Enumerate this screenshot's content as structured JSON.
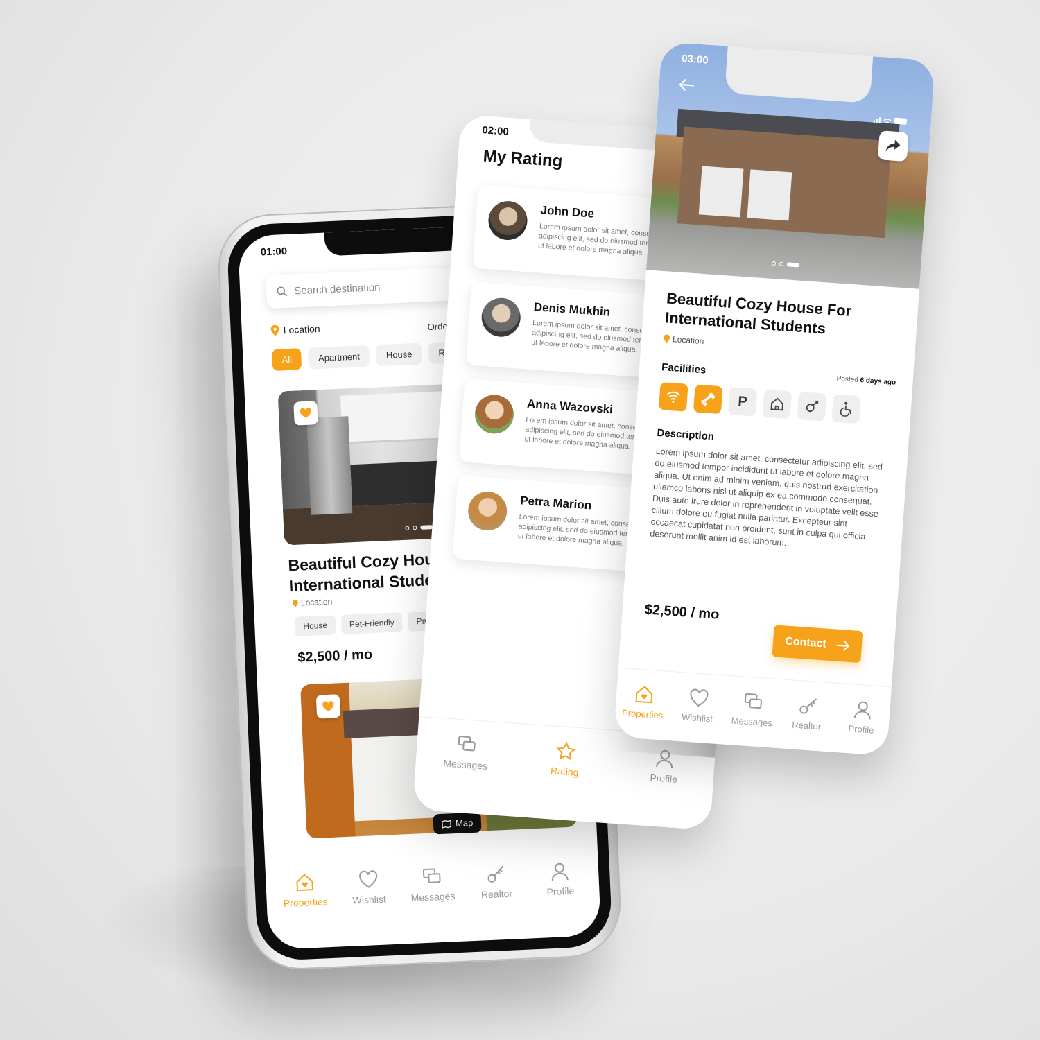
{
  "accent_color": "#f7a21b",
  "home_screen": {
    "time": "01:00",
    "search_placeholder": "Search destination",
    "location": "Location",
    "order_label": "Order",
    "filters": [
      "All",
      "Apartment",
      "House",
      "Ro"
    ],
    "listing1": {
      "title": "Beautiful Cozy House For International Students",
      "title_visible": "Beautiful Cozy Hou… International Stude…",
      "location": "Location",
      "tags": [
        "House",
        "Pet-Friendly",
        "Parking"
      ],
      "price": "$2,500 / mo",
      "icons": [
        "heart-icon"
      ]
    },
    "map_button": "Map",
    "nav": [
      {
        "label": "Properties",
        "icon": "home-icon",
        "active": true
      },
      {
        "label": "Wishlist",
        "icon": "heart-outline-icon",
        "active": false
      },
      {
        "label": "Messages",
        "icon": "chat-icon",
        "active": false
      },
      {
        "label": "Realtor",
        "icon": "key-icon",
        "active": false
      },
      {
        "label": "Profile",
        "icon": "user-icon",
        "active": false
      }
    ]
  },
  "rating_screen": {
    "time": "02:00",
    "title": "My Rating",
    "reviews": [
      {
        "name": "John Doe",
        "text": "Lorem ipsum dolor sit amet, consectetur adipiscing elit, sed do eiusmod tempor incididunt ut labore et dolore magna aliqua."
      },
      {
        "name": "Denis Mukhin",
        "text": "Lorem ipsum dolor sit amet, consectetur adipiscing elit, sed do eiusmod tempor incididunt ut labore et dolore magna aliqua."
      },
      {
        "name": "Anna Wazovski",
        "text": "Lorem ipsum dolor sit amet, consectetur adipiscing elit, sed do eiusmod tempor incididunt ut labore et dolore magna aliqua."
      },
      {
        "name": "Petra Marion",
        "text": "Lorem ipsum dolor sit amet, consectetur adipiscing elit, sed do eiusmod tempor incididunt ut labore et dolore magna aliqua."
      }
    ],
    "nav": [
      {
        "label": "Messages",
        "icon": "chat-icon",
        "active": false
      },
      {
        "label": "Rating",
        "icon": "star-icon",
        "active": true
      },
      {
        "label": "Profile",
        "icon": "user-icon",
        "active": false
      }
    ]
  },
  "detail_screen": {
    "time": "03:00",
    "title": "Beautiful Cozy House For International Students",
    "location": "Location",
    "facilities_label": "Facilities",
    "posted_prefix": "Posted",
    "posted_value": "6 days ago",
    "facilities": [
      {
        "icon": "wifi-icon",
        "active": true
      },
      {
        "icon": "pet-bone-icon",
        "active": true
      },
      {
        "icon": "parking-icon",
        "active": false,
        "text": "P"
      },
      {
        "icon": "house-icon",
        "active": false
      },
      {
        "icon": "gender-icon",
        "active": false
      },
      {
        "icon": "accessible-icon",
        "active": false
      }
    ],
    "description_label": "Description",
    "description": "Lorem ipsum dolor sit amet, consectetur adipiscing elit, sed do eiusmod tempor incididunt ut labore et dolore magna aliqua. Ut enim ad minim veniam, quis nostrud exercitation ullamco laboris nisi ut aliquip ex ea commodo consequat. Duis aute irure dolor in reprehenderit in voluptate velit esse cillum dolore eu fugiat nulla pariatur. Excepteur sint occaecat cupidatat non proident, sunt in culpa qui officia deserunt mollit anim id est laborum.",
    "price": "$2,500 / mo",
    "contact_button": "Contact",
    "nav": [
      {
        "label": "Properties",
        "icon": "home-icon",
        "active": true
      },
      {
        "label": "Wishlist",
        "icon": "heart-outline-icon",
        "active": false
      },
      {
        "label": "Messages",
        "icon": "chat-icon",
        "active": false
      },
      {
        "label": "Realtor",
        "icon": "key-icon",
        "active": false
      },
      {
        "label": "Profile",
        "icon": "user-icon",
        "active": false
      }
    ]
  }
}
